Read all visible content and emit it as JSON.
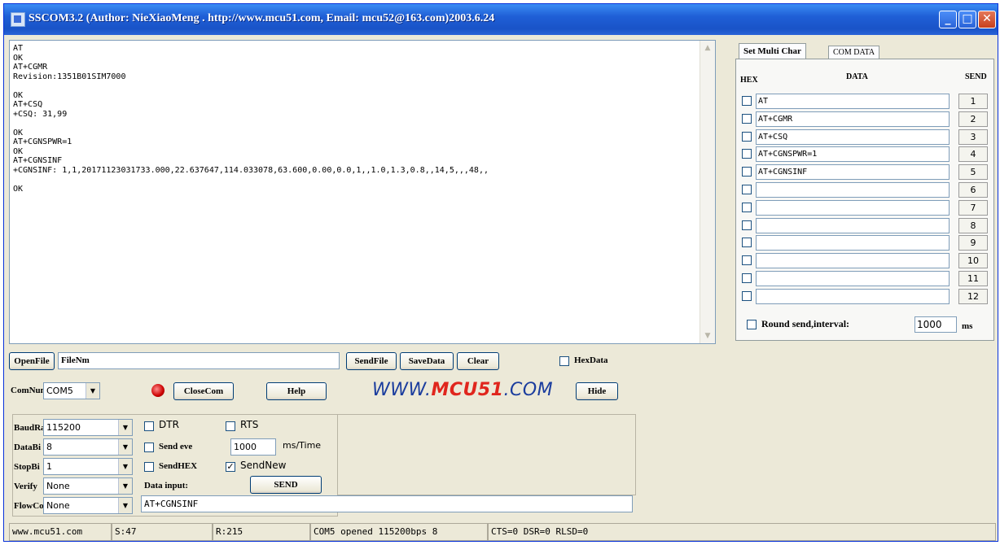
{
  "window": {
    "title": "SSCOM3.2 (Author: NieXiaoMeng .  http://www.mcu51.com,  Email: mcu52@163.com)2003.6.24"
  },
  "terminal": {
    "lines": [
      "AT",
      "OK",
      "AT+CGMR",
      "Revision:1351B01SIM7000",
      "",
      "OK",
      "AT+CSQ",
      "+CSQ: 31,99",
      "",
      "OK",
      "AT+CGNSPWR=1",
      "OK",
      "AT+CGNSINF",
      "+CGNSINF: 1,1,20171123031733.000,22.637647,114.033078,63.600,0.00,0.0,1,,1.0,1.3,0.8,,14,5,,,48,,",
      "",
      "OK"
    ]
  },
  "multi_char": {
    "tabs": [
      "Set Multi Char",
      "COM DATA"
    ],
    "headers": {
      "hex": "HEX",
      "data": "DATA",
      "send": "SEND"
    },
    "rows": [
      {
        "data": "AT",
        "send": "1"
      },
      {
        "data": "AT+CGMR",
        "send": "2"
      },
      {
        "data": "AT+CSQ",
        "send": "3"
      },
      {
        "data": "AT+CGNSPWR=1",
        "send": "4"
      },
      {
        "data": "AT+CGNSINF",
        "send": "5"
      },
      {
        "data": "",
        "send": "6"
      },
      {
        "data": "",
        "send": "7"
      },
      {
        "data": "",
        "send": "8"
      },
      {
        "data": "",
        "send": "9"
      },
      {
        "data": "",
        "send": "10"
      },
      {
        "data": "",
        "send": "11"
      },
      {
        "data": "",
        "send": "12"
      }
    ],
    "round_send_label": "Round send,interval:",
    "interval_value": "1000",
    "interval_unit": "ms"
  },
  "toolbar": {
    "open_file": "OpenFile",
    "file_name": "FileNm",
    "send_file": "SendFile",
    "save_data": "SaveData",
    "clear": "Clear",
    "hex_data": "HexData",
    "com_num_label": "ComNum",
    "com_num_value": "COM5",
    "close_com": "CloseCom",
    "help": "Help",
    "hide": "Hide",
    "logo_prefix": "WWW.",
    "logo_brand": "MCU51",
    "logo_suffix": ".COM"
  },
  "settings": {
    "baud_label": "BaudRa",
    "baud_value": "115200",
    "databits_label": "DataBi",
    "databits_value": "8",
    "stopbits_label": "StopBi",
    "stopbits_value": "1",
    "verify_label": "Verify",
    "verify_value": "None",
    "flow_label": "FlowCo",
    "flow_value": "None",
    "dtr": "DTR",
    "rts": "RTS",
    "send_every": "Send eve",
    "interval": "1000",
    "ms_time": "ms/Time",
    "send_hex": "SendHEX",
    "send_new": "SendNew",
    "data_input_label": "Data input:",
    "send_button": "SEND",
    "data_input_value": "AT+CGNSINF"
  },
  "status": {
    "site": "www.mcu51.com",
    "sent": "S:47",
    "received": "R:215",
    "port_state": "COM5 opened 115200bps  8",
    "lines": "CTS=0 DSR=0 RLSD=0"
  }
}
